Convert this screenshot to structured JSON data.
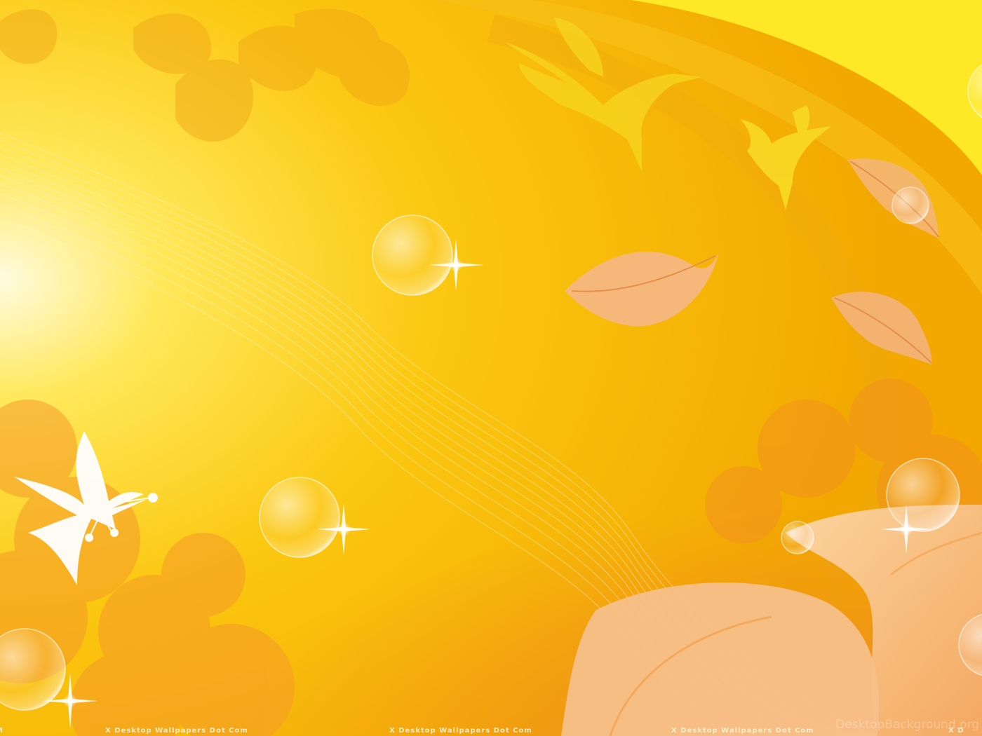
{
  "wallpaper": {
    "watermarks": {
      "left_fragment": "M",
      "repeat_1": "X Desktop Wallpapers Dot Com",
      "repeat_2": "X Desktop Wallpapers Dot Com",
      "repeat_3": "X Desktop Wallpapers Dot Com",
      "right_fragment": "X D"
    },
    "site_watermark": "DesktopBackground.org",
    "palette": {
      "base": "#f5b800",
      "highlight": "#fffbe0",
      "deep_orange": "#e8801a",
      "leaf_peach": "#f6c38a"
    }
  }
}
